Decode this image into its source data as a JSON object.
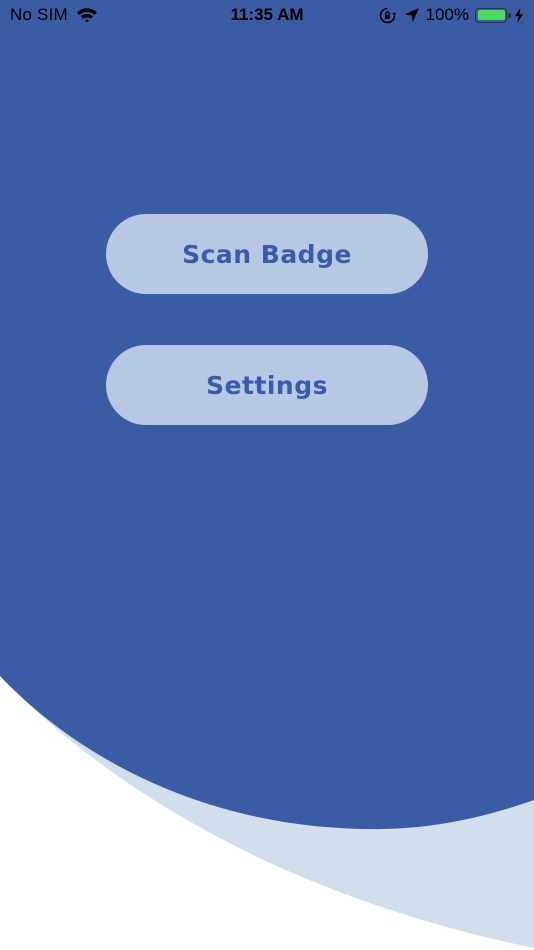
{
  "status_bar": {
    "carrier": "No SIM",
    "time": "11:35 AM",
    "battery_percent": "100%",
    "battery_level": 1.0,
    "battery_color": "#4cd964",
    "icons": [
      "wifi-icon",
      "orientation-lock-icon",
      "location-arrow-icon",
      "battery-icon",
      "charging-bolt-icon"
    ]
  },
  "colors": {
    "primary_blue": "#3b5ca5",
    "light_wave": "#d3deed",
    "button_fill": "#b6c8e4",
    "button_text": "#3a5ca6",
    "background": "#ffffff"
  },
  "menu": {
    "scan_badge_label": "Scan Badge",
    "settings_label": "Settings"
  }
}
